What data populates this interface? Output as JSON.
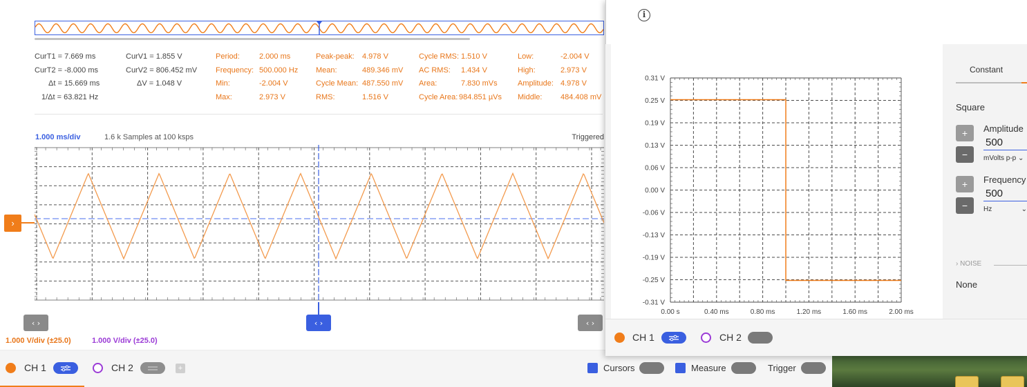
{
  "scope": {
    "cursors": {
      "col1": [
        "CurT1 = 7.669 ms",
        "CurT2 = -8.000 ms",
        "Δt = 15.669 ms",
        "1/Δt = 63.821 Hz"
      ],
      "col2": [
        "CurV1 = 1.855 V",
        "CurV2 = 806.452 mV",
        "ΔV = 1.048 V"
      ]
    },
    "measurements": {
      "col_a_labels": [
        "Period:",
        "Frequency:",
        "Min:",
        "Max:"
      ],
      "col_a_values": [
        "2.000 ms",
        "500.000 Hz",
        "-2.004 V",
        "2.973 V"
      ],
      "col_b_labels": [
        "Peak-peak:",
        "Mean:",
        "Cycle Mean:",
        "RMS:"
      ],
      "col_b_values": [
        "4.978 V",
        "489.346 mV",
        "487.550 mV",
        "1.516 V"
      ],
      "col_c_labels": [
        "Cycle RMS:",
        "AC RMS:",
        "Area:",
        "Cycle Area:"
      ],
      "col_c_values": [
        "1.510 V",
        "1.434 V",
        "7.830 mVs",
        "984.851 µVs"
      ],
      "col_d_labels": [
        "Low:",
        "High:",
        "Amplitude:",
        "Middle:"
      ],
      "col_d_values": [
        "-2.004 V",
        "2.973 V",
        "4.978 V",
        "484.408 mV"
      ]
    },
    "time_div": "1.000 ms/div",
    "samples": "1.6 k Samples at 100 ksps",
    "triggered": "Triggered",
    "ch1_vdiv": "1.000 V/div (±25.0)",
    "ch2_vdiv": "1.000 V/div (±25.0)",
    "nav_glyph": "‹ ›",
    "trigger_glyph": "›",
    "bottom": {
      "ch1": "CH 1",
      "ch2": "CH 2",
      "add_glyph": "+",
      "cursors": "Cursors",
      "measure": "Measure",
      "trigger": "Trigger"
    },
    "colors": {
      "ch1": "#f07d1a",
      "ch2": "#9b3bd6",
      "accent": "#3a5fe0"
    }
  },
  "wavegen": {
    "info_glyph": "i",
    "tab_constant": "Constant",
    "waveform": "Square",
    "amplitude_label": "Amplitude",
    "amplitude_value": "500",
    "amplitude_unit": "mVolts p-p",
    "frequency_label": "Frequency",
    "frequency_value": "500",
    "frequency_unit": "Hz",
    "plus_glyph": "+",
    "minus_glyph": "−",
    "noise_label": "NOISE",
    "noise_value": "None",
    "bottom": {
      "ch1": "CH 1",
      "ch2": "CH 2"
    }
  },
  "chart_data": [
    {
      "type": "line",
      "name": "scope-ch1",
      "x_range_divs": [
        0,
        10
      ],
      "y_range_divs": [
        -4,
        4
      ],
      "waveform": "triangle",
      "cycles_visible": 8,
      "y_min_div": -2.004,
      "y_max_div": 2.973,
      "cursor_x_div": 5.4,
      "trigger_level_div": 0.0,
      "grid": true
    },
    {
      "type": "line",
      "name": "wavegen-preview",
      "x_tick_labels": [
        "0.00 s",
        "0.40 ms",
        "0.80 ms",
        "1.20 ms",
        "1.60 ms",
        "2.00 ms"
      ],
      "y_tick_labels": [
        "0.31 V",
        "0.25 V",
        "0.19 V",
        "0.13 V",
        "0.06 V",
        "0.00 V",
        "-0.06 V",
        "-0.13 V",
        "-0.19 V",
        "-0.25 V",
        "-0.31 V"
      ],
      "x_range_ms": [
        0,
        2.0
      ],
      "y_range_v": [
        -0.31,
        0.31
      ],
      "points_ms_v": [
        [
          0,
          0.25
        ],
        [
          1.0,
          0.25
        ],
        [
          1.0,
          -0.25
        ],
        [
          2.0,
          -0.25
        ]
      ],
      "grid": true
    }
  ]
}
